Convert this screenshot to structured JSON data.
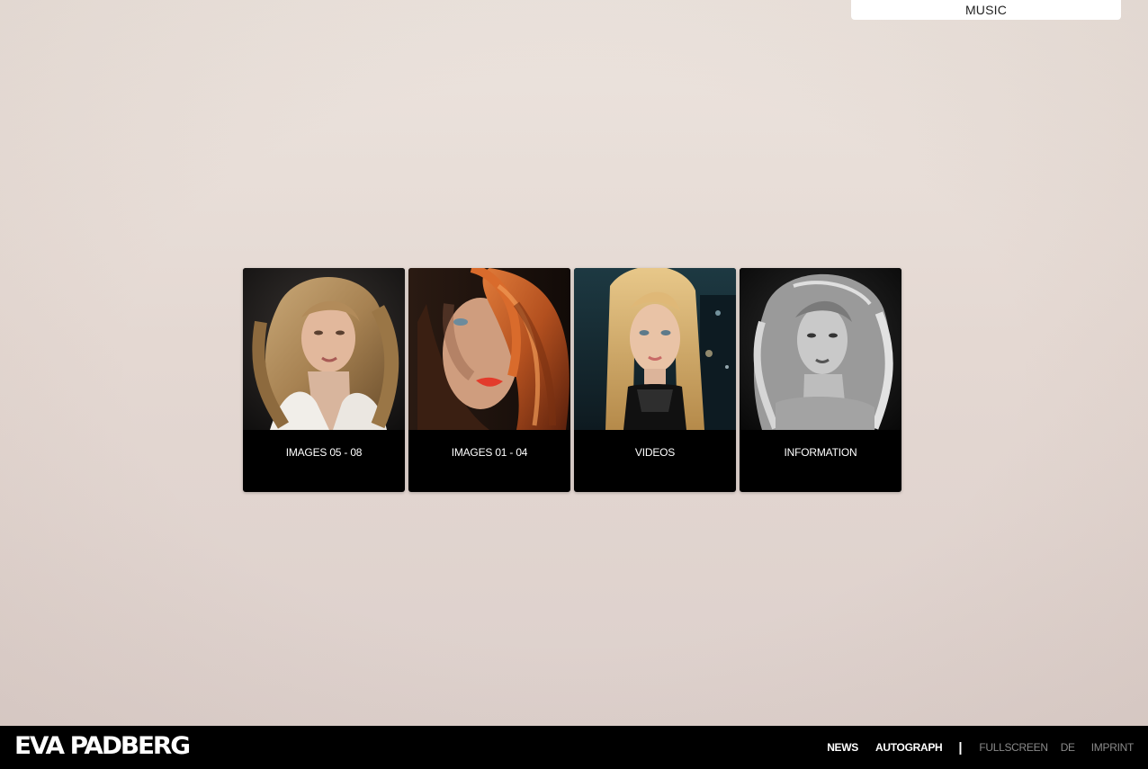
{
  "music_tab": {
    "label": "MUSIC"
  },
  "tiles": [
    {
      "label": "IMAGES 05 - 08",
      "photo": "portrait-wavy-blonde-white-shirt"
    },
    {
      "label": "IMAGES 01 - 04",
      "photo": "portrait-red-hair-over-eye"
    },
    {
      "label": "VIDEOS",
      "photo": "portrait-blonde-night-city"
    },
    {
      "label": "INFORMATION",
      "photo": "portrait-black-and-white"
    }
  ],
  "footer": {
    "logo": "EVA PADBERG",
    "nav_main": [
      "NEWS",
      "AUTOGRAPH"
    ],
    "separator": "|",
    "nav_minor": [
      "FULLSCREEN",
      "DE",
      "IMPRINT"
    ]
  },
  "colors": {
    "footer_bg": "#000000",
    "tile_bg": "#000000",
    "page_bg": "#e6dbd5",
    "minor_link": "#8a8a8a"
  }
}
